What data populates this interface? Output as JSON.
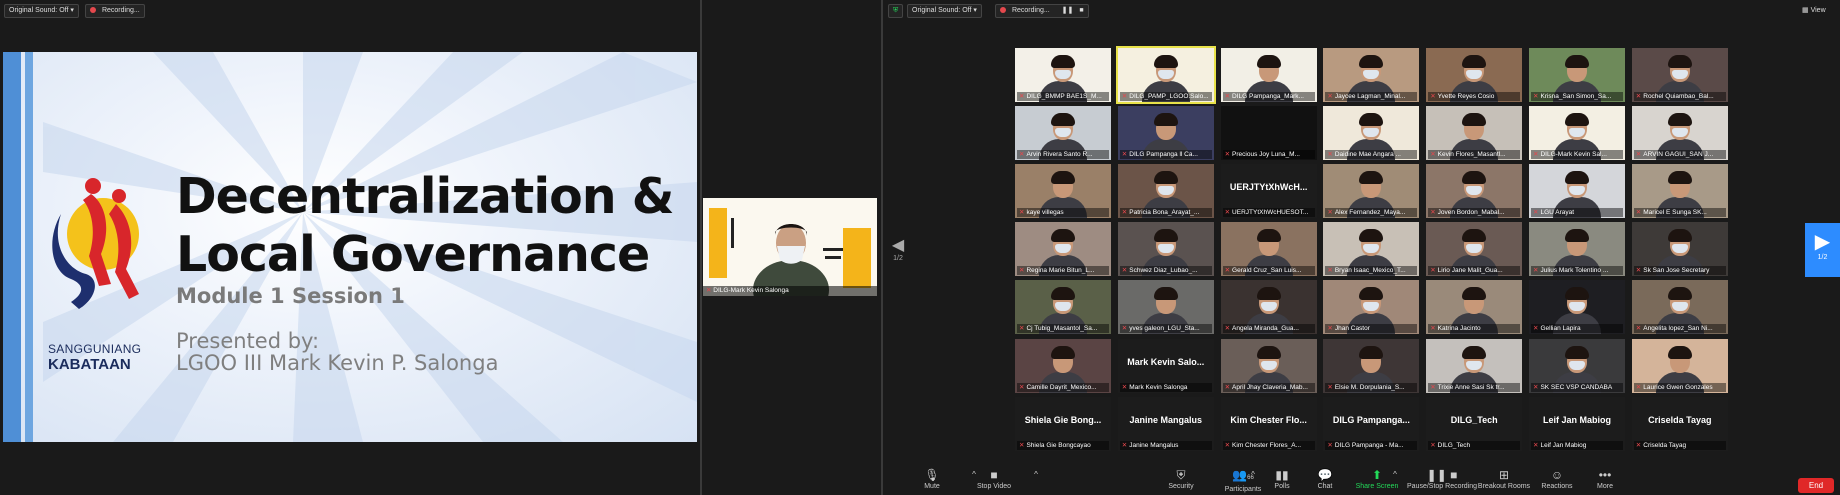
{
  "left_window": {
    "original_sound": "Original Sound: Off",
    "recording": "Recording..."
  },
  "slide": {
    "title_line1": "Decentralization &",
    "title_line2": "Local Governance",
    "subtitle": "Module 1 Session 1",
    "presented_by": "Presented by:",
    "presenter": "LGOO III Mark Kevin P. Salonga",
    "logo_text1": "SANGGUNIANG",
    "logo_text2": "KABATAAN"
  },
  "self_view": {
    "name": "DILG-Mark Kevin Salonga"
  },
  "right_window": {
    "original_sound": "Original Sound: Off",
    "recording": "Recording...",
    "view_label": "View",
    "page_indicator_left": "1/2",
    "page_indicator_right": "1/2"
  },
  "participants": [
    {
      "name": "DILG_BMMP BAE1S_M...",
      "type": "video",
      "bg": "#f3f0e8"
    },
    {
      "name": "DILG_PAMP_LGOO.Salo...",
      "type": "video",
      "bg": "#f5f0e0"
    },
    {
      "name": "DILG Pampanga_Mark...",
      "type": "video",
      "bg": "#f2efe6"
    },
    {
      "name": "Jaycee Lagman_Minal...",
      "type": "video",
      "bg": "#b89a80"
    },
    {
      "name": "Yvette Reyes Cosio",
      "type": "video",
      "bg": "#8a6a52"
    },
    {
      "name": "Krisna_San Simon_Sa...",
      "type": "video",
      "bg": "#6e8a5a"
    },
    {
      "name": "Rochel Quiambao_Bal...",
      "type": "video",
      "bg": "#5a4a48"
    },
    {
      "name": "Arvin Rivera Santo R...",
      "type": "video",
      "bg": "#c7ccd2"
    },
    {
      "name": "DILG Pampanga ll Ca...",
      "type": "video",
      "bg": "#3b3e60"
    },
    {
      "name": "Precious Joy Luna_M...",
      "type": "dark",
      "bg": "#111111"
    },
    {
      "name": "Daidine Mae Angara ...",
      "type": "video",
      "bg": "#efe8da"
    },
    {
      "name": "Kevin Flores_Masantl...",
      "type": "video",
      "bg": "#c6c0b8"
    },
    {
      "name": "DILG-Mark Kevin Sal...",
      "type": "video",
      "bg": "#f3efe3"
    },
    {
      "name": "ARVIN GAGUI_SAN J...",
      "type": "video",
      "bg": "#d8d4cf"
    },
    {
      "name": "kaye villegas",
      "type": "video",
      "bg": "#9a8068"
    },
    {
      "name": "Patricia Bona_Arayat_...",
      "type": "video",
      "bg": "#6b5448"
    },
    {
      "name": "UERJTYtXhWcHUESOT...",
      "type": "text",
      "big": "UERJTYtXhWcH...",
      "bg": "#1c1c1c"
    },
    {
      "name": "Alex Fernandez_Maya...",
      "type": "video",
      "bg": "#a08c76"
    },
    {
      "name": "Joven Bordon_Mabal...",
      "type": "video",
      "bg": "#8c7668"
    },
    {
      "name": "LGU Arayat",
      "type": "video",
      "bg": "#d4d6da"
    },
    {
      "name": "Maricel E Sunga SK...",
      "type": "video",
      "bg": "#a89a88"
    },
    {
      "name": "Regina Marie Bitun_L...",
      "type": "video",
      "bg": "#9e8c82"
    },
    {
      "name": "Schwez Diaz_Lubao_...",
      "type": "video",
      "bg": "#5a5250"
    },
    {
      "name": "Gerald Cruz_San Luis...",
      "type": "video",
      "bg": "#8a7260"
    },
    {
      "name": "Bryan Isaac_Mexico_T...",
      "type": "video",
      "bg": "#c8c0b6"
    },
    {
      "name": "Lirio Jane Malit_Gua...",
      "type": "video",
      "bg": "#6a5a54"
    },
    {
      "name": "Julius Mark Tolentino ...",
      "type": "video",
      "bg": "#8a8a80"
    },
    {
      "name": "Sk San Jose Secretary",
      "type": "video",
      "bg": "#3e3a38"
    },
    {
      "name": "Cj Tubig_Masantol_Sa...",
      "type": "video",
      "bg": "#5a6048"
    },
    {
      "name": "yves galeon_LGU_Sta...",
      "type": "video",
      "bg": "#6a6a68"
    },
    {
      "name": "Angela Miranda_Gua...",
      "type": "video",
      "bg": "#3a3230"
    },
    {
      "name": "Jhan Castor",
      "type": "video",
      "bg": "#a08878"
    },
    {
      "name": "Katrina Jacinto",
      "type": "video",
      "bg": "#9a8a7a"
    },
    {
      "name": "Gellian Lapira",
      "type": "video",
      "bg": "#1e1e22"
    },
    {
      "name": "Angelita lopez_San Ni...",
      "type": "video",
      "bg": "#7a6a5a"
    },
    {
      "name": "Camille Dayrit_Mexico...",
      "type": "video",
      "bg": "#5a4444"
    },
    {
      "name": "Mark Kevin Salonga",
      "type": "text",
      "big": "Mark Kevin Salo...",
      "bg": "#1c1c1c"
    },
    {
      "name": "April Jhay Claveria_Mab...",
      "type": "video",
      "bg": "#6a5e58"
    },
    {
      "name": "Elsie M. Dorpulania_S...",
      "type": "video",
      "bg": "#3e3636"
    },
    {
      "name": "Trixie Anne Sasi Sk tr...",
      "type": "video",
      "bg": "#c4c0bc"
    },
    {
      "name": "SK SEC VSP CANDABA",
      "type": "video",
      "bg": "#3a3a3c"
    },
    {
      "name": "Laurice Gwen Gonzales",
      "type": "video",
      "bg": "#d4b49a"
    },
    {
      "name": "Shiela Gie Bongcayao",
      "type": "text",
      "big": "Shiela Gie Bong...",
      "bg": "#1c1c1c"
    },
    {
      "name": "Janine Mangalus",
      "type": "text",
      "big": "Janine Mangalus",
      "bg": "#1c1c1c"
    },
    {
      "name": "Kim Chester Flores_A...",
      "type": "text",
      "big": "Kim Chester Flo...",
      "bg": "#1c1c1c"
    },
    {
      "name": "DILG Pampanga - Ma...",
      "type": "text",
      "big": "DILG Pampanga...",
      "bg": "#1c1c1c"
    },
    {
      "name": "DILG_Tech",
      "type": "text",
      "big": "DILG_Tech",
      "bg": "#1c1c1c"
    },
    {
      "name": "Leif Jan Mabiog",
      "type": "text",
      "big": "Leif Jan Mabiog",
      "bg": "#1c1c1c"
    },
    {
      "name": "Criselda Tayag",
      "type": "text",
      "big": "Criselda Tayag",
      "bg": "#1c1c1c"
    }
  ],
  "toolbar": {
    "mute": "Mute",
    "stop_video": "Stop Video",
    "security": "Security",
    "participants": "Participants",
    "participants_count": "66",
    "polls": "Polls",
    "chat": "Chat",
    "share_screen": "Share Screen",
    "pause_stop_recording": "Pause/Stop Recording",
    "breakout_rooms": "Breakout Rooms",
    "reactions": "Reactions",
    "more": "More",
    "end": "End"
  }
}
